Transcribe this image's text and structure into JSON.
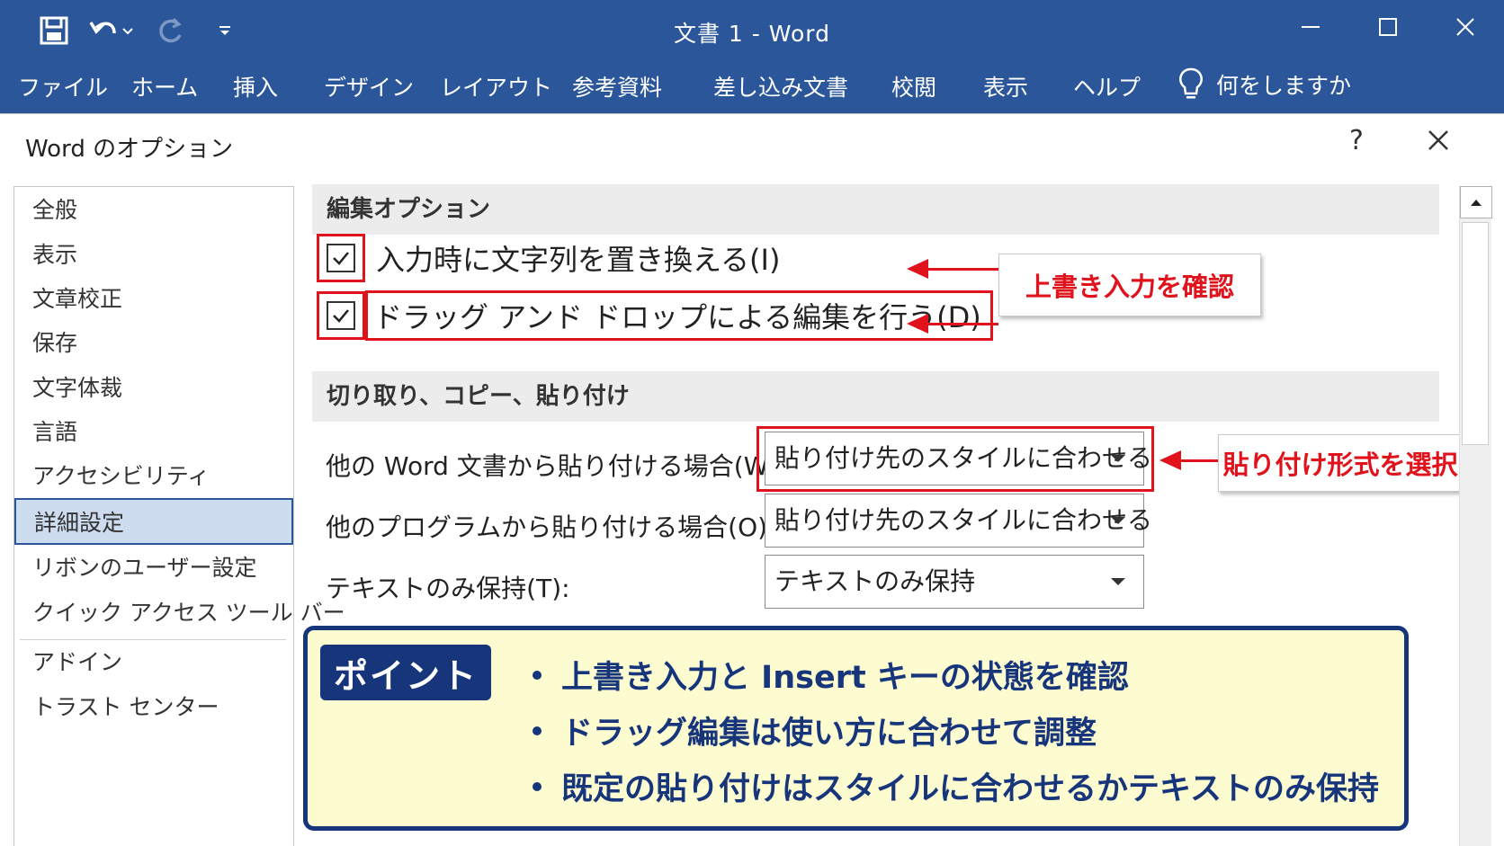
{
  "window": {
    "title": "文書 1 - Word"
  },
  "ribbon": {
    "tabs": [
      "ファイル",
      "ホーム",
      "挿入",
      "デザイン",
      "レイアウト",
      "参考資料",
      "差し込み文書",
      "校閲",
      "表示",
      "ヘルプ"
    ],
    "tell_me": "何をしますか"
  },
  "dialog": {
    "title": "Word のオプション",
    "help": "?",
    "nav_items": [
      "全般",
      "表示",
      "文章校正",
      "保存",
      "文字体裁",
      "言語",
      "アクセシビリティ",
      "詳細設定",
      "リボンのユーザー設定",
      "クイック アクセス ツール バー",
      "アドイン",
      "トラスト センター"
    ],
    "selected_nav": "詳細設定"
  },
  "editing": {
    "heading": "編集オプション",
    "options": [
      {
        "label": "入力時に文字列を置き換える(I)",
        "checked": true
      },
      {
        "label": "ドラッグ アンド ドロップによる編集を行う(D)",
        "checked": true
      }
    ]
  },
  "paste": {
    "heading": "切り取り、コピー、貼り付け",
    "rows": [
      {
        "label": "他の Word 文書から貼り付ける場合(W):",
        "value": "貼り付け先のスタイルに合わせる"
      },
      {
        "label": "他のプログラムから貼り付ける場合(O):",
        "value": "貼り付け先のスタイルに合わせる"
      },
      {
        "label": "テキストのみ保持(T):",
        "value": "テキストのみ保持"
      }
    ]
  },
  "callouts": {
    "overwrite": "上書き入力を確認",
    "paste_format": "貼り付け形式を選択"
  },
  "point": {
    "badge": "ポイント",
    "lines": [
      "上書き入力と Insert キーの状態を確認",
      "ドラッグ編集は使い方に合わせて調整",
      "既定の貼り付けはスタイルに合わせるかテキストのみ保持"
    ]
  },
  "colors": {
    "title_bar": "#2b579a",
    "highlight": "#e0121b",
    "point_border": "#16357a",
    "point_bg": "#fdfbd0"
  }
}
